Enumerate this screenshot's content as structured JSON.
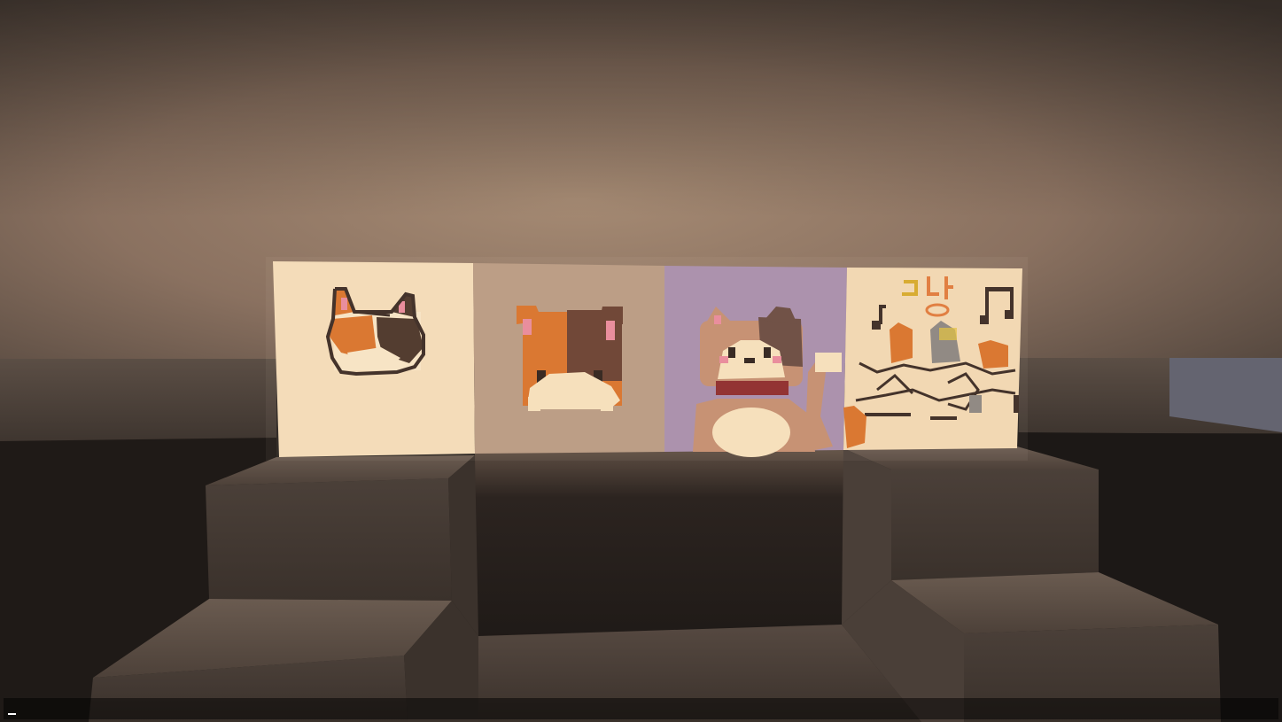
{
  "scene": {
    "type": "first-person game view",
    "description_text": "",
    "maps": [
      {
        "subject": "calico-cat-head-outline",
        "background": "#f4dcb8"
      },
      {
        "subject": "calico-cat-peeking",
        "background": "#b99a82"
      },
      {
        "subject": "cat-with-red-collar",
        "background": "#a88eab"
      },
      {
        "subject": "dancing-cats-with-music-notes",
        "background": "#f2d7b2"
      }
    ],
    "colors": {
      "ceiling": "#8a7160",
      "wall": "#4b4038",
      "shadow": "#1c1714",
      "stair": "#5a4d43",
      "orange": "#d9722a",
      "brown": "#5e3b2c",
      "pink": "#e8899a",
      "cream": "#f6e0bb"
    }
  },
  "chat": {
    "input_value": "",
    "cursor_glyph": "_"
  }
}
